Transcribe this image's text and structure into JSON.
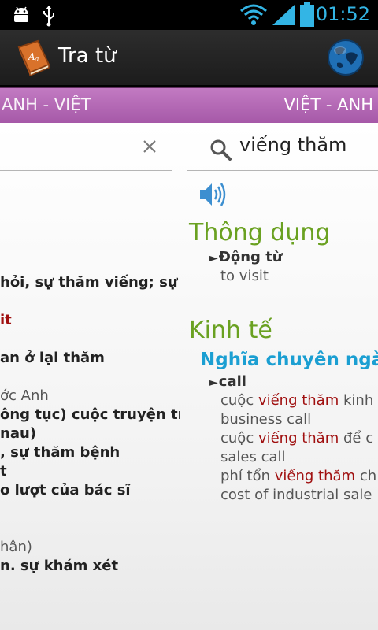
{
  "status_bar": {
    "time": "01:52",
    "icons": [
      "android-debug-icon",
      "usb-icon",
      "wifi-icon",
      "signal-icon",
      "battery-icon"
    ]
  },
  "action_bar": {
    "title": "Tra từ",
    "app_icon": "dictionary-book-icon",
    "action_icon": "globe-icon"
  },
  "tabs": {
    "left": "ANH - VIỆT",
    "right": "VIỆT - ANH"
  },
  "colors": {
    "tab_strip": "#b66bb6",
    "heading_green": "#6aa121",
    "subheading_blue": "#1b9fd2",
    "highlight_red": "#a01010",
    "status_blue": "#33b5e5"
  },
  "left_page": {
    "lines": [
      "hỏi, sự thăm viếng; sự ở",
      "it",
      "an ở lại thăm",
      "ớc Anh",
      "ông tục) cuộc truyện trò",
      "nau)",
      ", sự thăm bệnh",
      "t",
      "o lượt của bác sĩ",
      "hân)",
      "n. sự khám xét"
    ]
  },
  "right_page": {
    "search_value": "viếng thăm",
    "sections": [
      {
        "heading": "Thông dụng",
        "pos": "Động từ",
        "meanings": [
          "to visit"
        ]
      },
      {
        "heading": "Kinh tế",
        "subheading": "Nghĩa chuyên ngàn",
        "pos": "call",
        "examples": [
          {
            "pre": "cuộc ",
            "hl": "viếng thăm",
            "post": " kinh"
          },
          {
            "pre": "business call",
            "hl": "",
            "post": ""
          },
          {
            "pre": "cuộc ",
            "hl": "viếng thăm",
            "post": " để c"
          },
          {
            "pre": "sales call",
            "hl": "",
            "post": ""
          },
          {
            "pre": "phí tổn ",
            "hl": "viếng thăm",
            "post": " ch"
          },
          {
            "pre": "cost of industrial sale",
            "hl": "",
            "post": ""
          }
        ]
      }
    ]
  }
}
